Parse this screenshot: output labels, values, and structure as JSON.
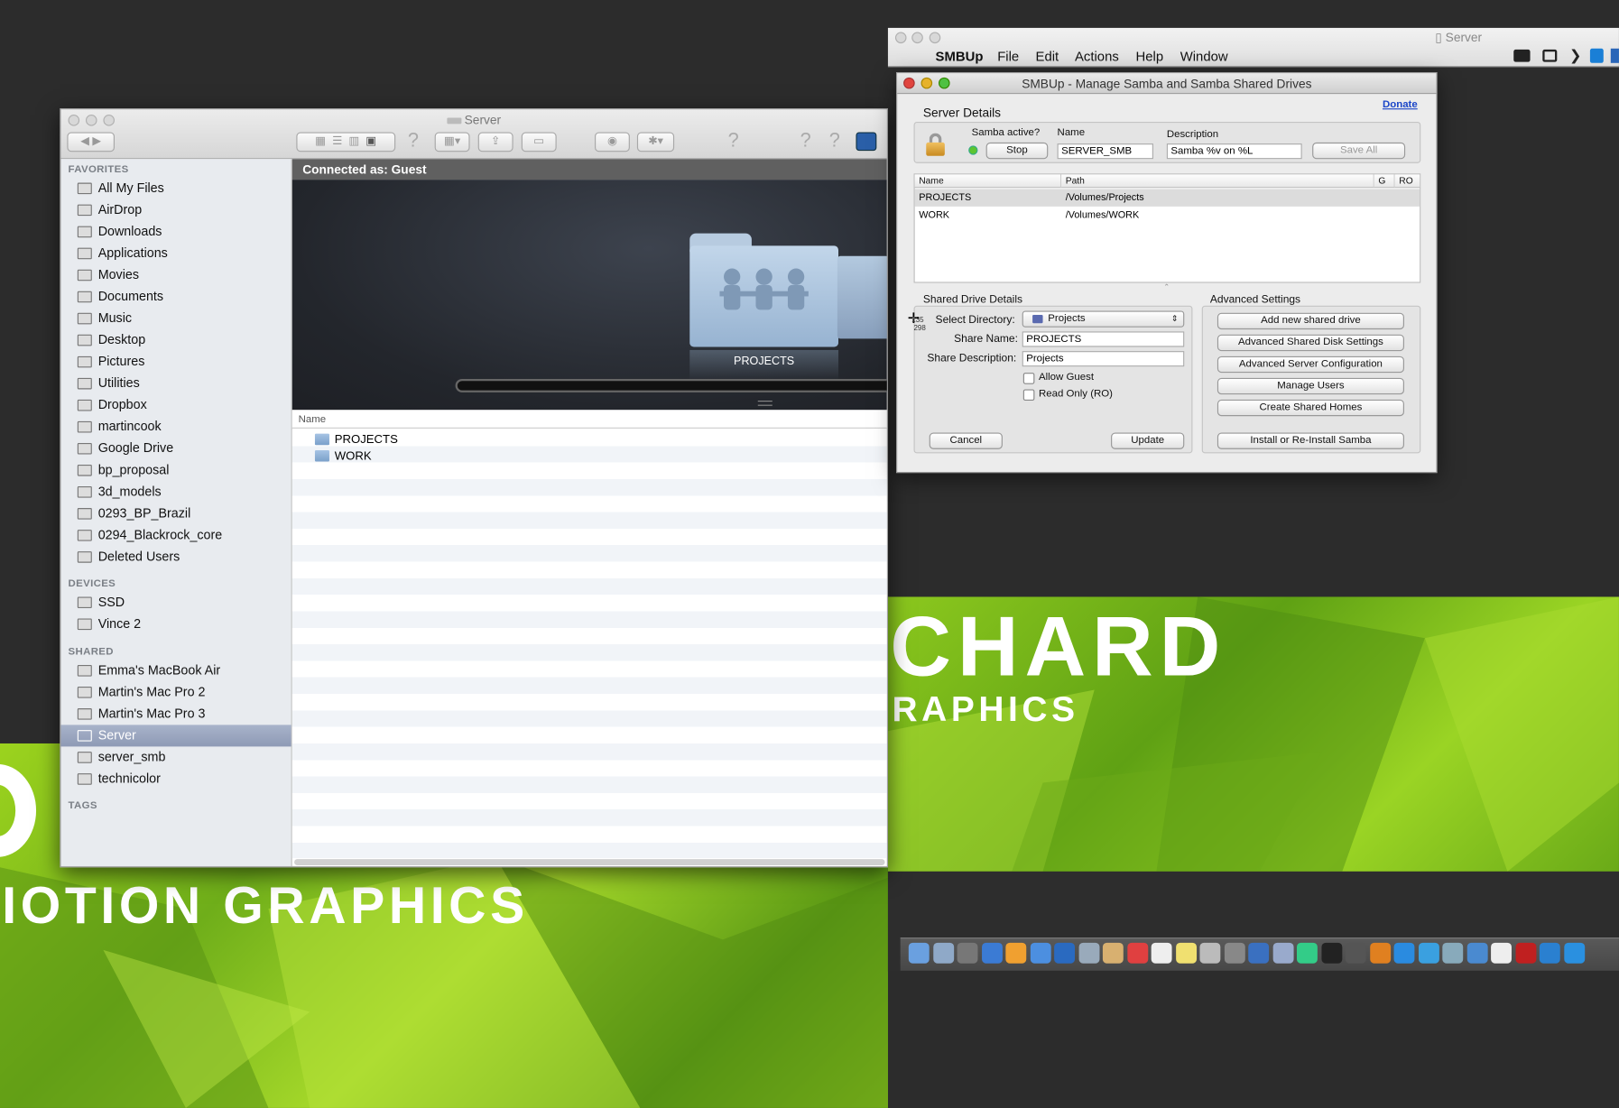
{
  "wallpaper": {
    "left_text_1": "IOTION GRAPHICS",
    "right_text_1": "CHARD",
    "right_text_2": "RAPHICS"
  },
  "finder": {
    "title": "Server",
    "connected_as": "Connected as: Guest",
    "cover_folder_label": "PROJECTS",
    "list_header_name": "Name",
    "files": [
      "PROJECTS",
      "WORK"
    ],
    "sidebar": {
      "favorites_header": "FAVORITES",
      "favorites": [
        "All My Files",
        "AirDrop",
        "Downloads",
        "Applications",
        "Movies",
        "Documents",
        "Music",
        "Desktop",
        "Pictures",
        "Utilities",
        "Dropbox",
        "martincook",
        "Google Drive",
        "bp_proposal",
        "3d_models",
        "0293_BP_Brazil",
        "0294_Blackrock_core",
        "Deleted Users"
      ],
      "devices_header": "DEVICES",
      "devices": [
        "SSD",
        "Vince 2"
      ],
      "shared_header": "SHARED",
      "shared": [
        "Emma's MacBook Air",
        "Martin's Mac Pro 2",
        "Martin's Mac Pro 3",
        "Server",
        "server_smb",
        "technicolor"
      ],
      "selected": "Server",
      "tags_header": "TAGS"
    }
  },
  "menubar": {
    "window_title": "Server",
    "app": "SMBUp",
    "items": [
      "File",
      "Edit",
      "Actions",
      "Help",
      "Window"
    ]
  },
  "smbup": {
    "title": "SMBUp - Manage Samba and Samba Shared Drives",
    "donate": "Donate",
    "server_details": "Server Details",
    "samba_active_label": "Samba active?",
    "stop_button": "Stop",
    "name_label": "Name",
    "name_value": "SERVER_SMB",
    "description_label": "Description",
    "description_value": "Samba %v on %L",
    "save_all": "Save All",
    "table_headers": [
      "Name",
      "Path",
      "G",
      "RO"
    ],
    "shares": [
      {
        "name": "PROJECTS",
        "path": "/Volumes/Projects"
      },
      {
        "name": "WORK",
        "path": "/Volumes/WORK"
      }
    ],
    "shared_drive_details": "Shared Drive Details",
    "select_directory_label": "Select Directory:",
    "select_directory_value": "Projects",
    "share_name_label": "Share Name:",
    "share_name_value": "PROJECTS",
    "share_description_label": "Share Description:",
    "share_description_value": "Projects",
    "allow_guest": "Allow Guest",
    "read_only": "Read Only (RO)",
    "cancel": "Cancel",
    "update": "Update",
    "advanced_settings": "Advanced Settings",
    "advanced_buttons": [
      "Add new shared drive",
      "Advanced Shared Disk Settings",
      "Advanced Server Configuration",
      "Manage Users",
      "Create Shared Homes"
    ],
    "install_button": "Install or Re-Install Samba",
    "cursor_readout_1": "135",
    "cursor_readout_2": "298"
  },
  "colors": {
    "wallpaper_green": "#8cc81e",
    "selection": "#99a5c0",
    "status_green": "#5cc531",
    "link_blue": "#1a45c8"
  }
}
